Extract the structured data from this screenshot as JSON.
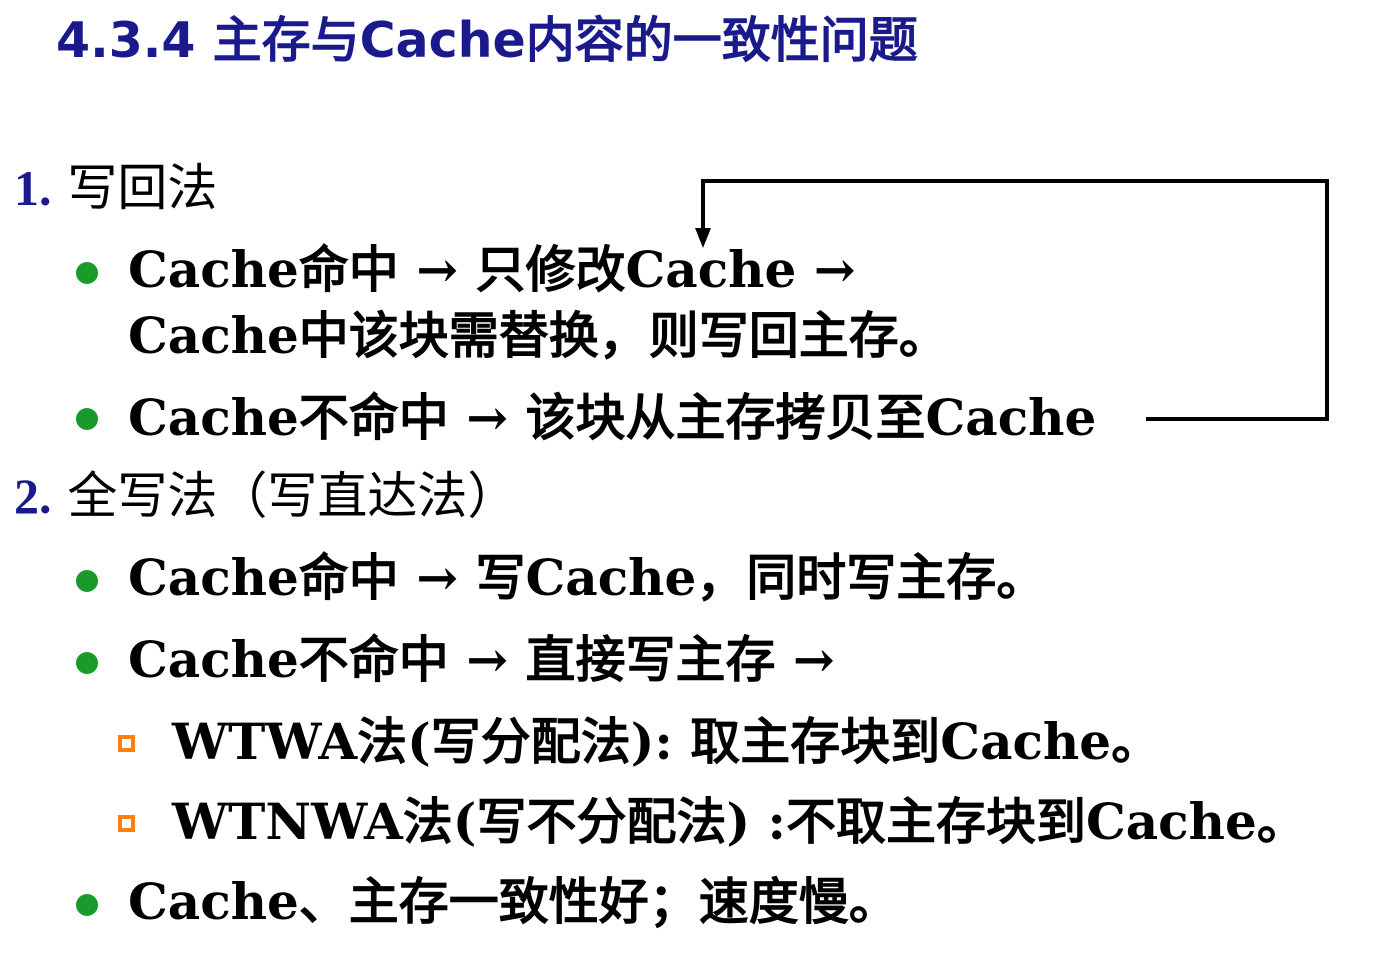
{
  "title": "4.3.4 主存与Cache内容的一致性问题",
  "write_back": {
    "number": "1.",
    "label": "写回法",
    "hit_line1": "Cache命中 → 只修改Cache →",
    "hit_line2": "Cache中该块需替换，则写回主存。",
    "miss": "Cache不命中 → 该块从主存拷贝至Cache"
  },
  "write_through": {
    "number": "2.",
    "label": "全写法（写直达法）",
    "hit": "Cache命中 → 写Cache，同时写主存。",
    "miss": "Cache不命中 → 直接写主存 →",
    "wtwa": "WTWA法(写分配法): 取主存块到Cache。",
    "wtnwa": "WTNWA法(写不分配法) :不取主存块到Cache。",
    "summary": "Cache、主存一致性好；速度慢。"
  },
  "colors": {
    "heading": "#1a1a8c",
    "bullet": "#1a9a2a",
    "sub_bullet": "#ff7f0e",
    "text": "#000000"
  }
}
